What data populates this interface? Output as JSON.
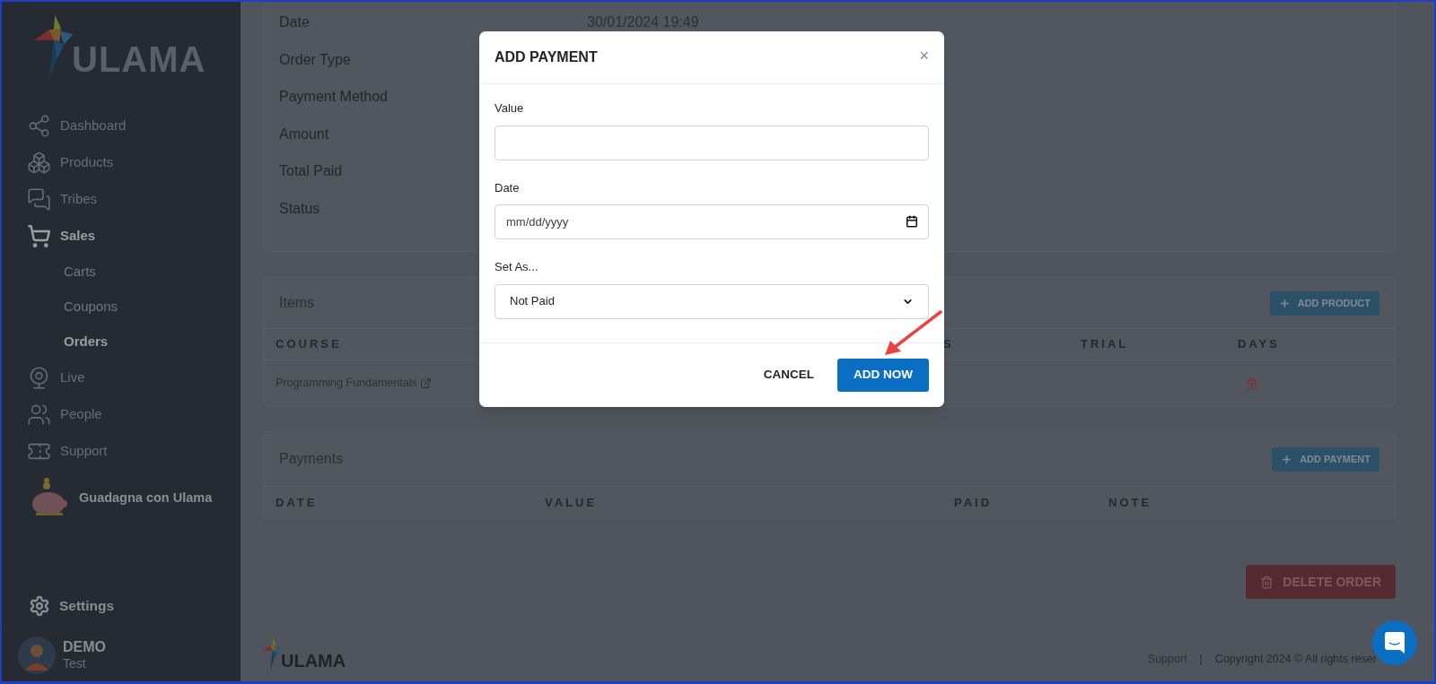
{
  "sidebar": {
    "logo": "ULAMA",
    "nav": [
      {
        "label": "Dashboard",
        "selected": false
      },
      {
        "label": "Products",
        "selected": false
      },
      {
        "label": "Tribes",
        "selected": false
      },
      {
        "label": "Sales",
        "selected": true,
        "children": [
          {
            "label": "Carts",
            "selected": false
          },
          {
            "label": "Coupons",
            "selected": false
          },
          {
            "label": "Orders",
            "selected": true
          }
        ]
      },
      {
        "label": "Live",
        "selected": false
      },
      {
        "label": "People",
        "selected": false
      },
      {
        "label": "Support",
        "selected": false
      }
    ],
    "promo": "Guadagna con Ulama",
    "settings": "Settings",
    "user": {
      "name": "DEMO",
      "role": "Test"
    }
  },
  "order_details": {
    "fields": [
      {
        "label": "Date",
        "value": "30/01/2024 19:49"
      },
      {
        "label": "Order Type"
      },
      {
        "label": "Payment Method"
      },
      {
        "label": "Amount"
      },
      {
        "label": "Total Paid"
      },
      {
        "label": "Status"
      }
    ]
  },
  "items": {
    "title": "Items",
    "add_button": "ADD PRODUCT",
    "columns": [
      "COURSE",
      "S",
      "TRIAL",
      "DAYS"
    ],
    "rows": [
      {
        "course": "Programming Fundamentals"
      }
    ]
  },
  "payments": {
    "title": "Payments",
    "add_button": "ADD PAYMENT",
    "columns": [
      "DATE",
      "VALUE",
      "PAID",
      "NOTE"
    ]
  },
  "delete_button": "DELETE ORDER",
  "footer": {
    "logo": "ULAMA",
    "link": "Support",
    "separator": "|",
    "copyright": "Copyright 2024 © All rights reser"
  },
  "modal": {
    "title": "ADD PAYMENT",
    "close": "×",
    "fields": [
      {
        "kind": "text",
        "label": "Value"
      },
      {
        "kind": "date",
        "label": "Date",
        "placeholder": "mm/dd/yyyy"
      },
      {
        "kind": "select",
        "label": "Set As...",
        "value": "Not Paid"
      }
    ],
    "cancel": "CANCEL",
    "submit": "ADD NOW"
  }
}
